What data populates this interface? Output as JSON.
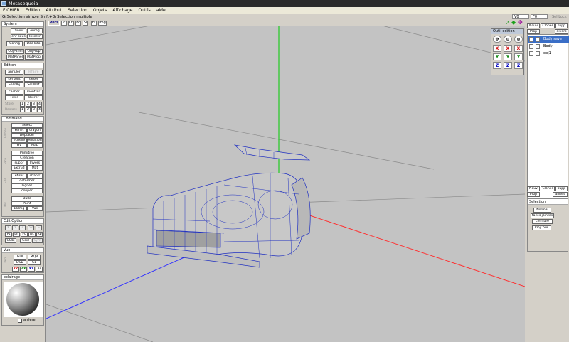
{
  "window": {
    "title": "Metasequoia"
  },
  "menu": [
    "FICHIER",
    "Edition",
    "Attribut",
    "Selection",
    "Objets",
    "Affichage",
    "Outils",
    "aide"
  ],
  "status": {
    "hint": "GrSelection simple  Shift+GrSelection multiple",
    "v_label": "V0",
    "f_label": "F0",
    "sel_lock": "Sel Lock"
  },
  "system": {
    "title": "System",
    "buttons": [
      "Ouvrir",
      "enreg",
      "enr sous",
      "Inserer",
      "Config",
      "Doc Info",
      "ObjPanel",
      "ObjProp",
      "MatPanel",
      "MatProp"
    ]
  },
  "edition": {
    "title": "Edition",
    "buttons": [
      "annuler",
      "refaire",
      "sel tout",
      "desel",
      "Sel Obj",
      "Sel Mat",
      "cacher",
      "montrer",
      "Fixer",
      "liberer"
    ],
    "store_label": "Store",
    "restore_label": "Restore",
    "nums": [
      "1",
      "2",
      "3",
      "4"
    ]
  },
  "command": {
    "title": "Command",
    "buttons": [
      "Select",
      "Fenet",
      "crayon",
      "Deplacer",
      "echelle",
      "Rotation",
      "HV",
      "Map",
      "Primitive",
      "Creation",
      "suppr",
      "Invers",
      "Extrud",
      "Mat",
      "etirer",
      "chanfr",
      "deformer",
      "Lignes",
      "couper",
      "Bulle",
      "Paint",
      "BkImg",
      "Vue"
    ],
    "side_labels": [
      "Edition",
      "Face",
      "Edit",
      "Mis"
    ]
  },
  "edit_option": {
    "title": "Edit Option",
    "buttons": [
      "X",
      "Y",
      "Z",
      "W",
      "S",
      "Pt",
      "Ln",
      "Fc",
      "Rc",
      "Rp",
      "CObj",
      "Grid",
      "Sym"
    ]
  },
  "vue": {
    "title": "Vue",
    "buttons": [
      "GDI",
      "MQR",
      "DSD",
      "GL",
      "YZ",
      "ZX",
      "XY",
      "Ar"
    ],
    "side_label": "Pers"
  },
  "eclairage": {
    "title": "eclairage",
    "checkbox_label": "arriere"
  },
  "viewport": {
    "tabs": [
      "Pers",
      "Pt",
      "Ln",
      "Fc",
      "Sl",
      "Fr",
      "Img"
    ],
    "active_tab": "Pers",
    "icons": [
      "nav-arrow-icon",
      "move-icon",
      "rotate-icon"
    ]
  },
  "outil": {
    "title": "Outil edition",
    "rows": [
      [
        "✥",
        "⊙",
        "⊚"
      ],
      [
        "X",
        "X",
        "X"
      ],
      [
        "Y",
        "Y",
        "Y"
      ],
      [
        "Z",
        "Z",
        "Z"
      ]
    ],
    "colors": {
      "X": "#d00000",
      "Y": "#008000",
      "Z": "#0000c0"
    }
  },
  "objects": {
    "buttons": [
      "Nouv",
      "Cloner",
      "supp",
      "Prop",
      "divers"
    ],
    "items": [
      {
        "name": "Body save",
        "selected": true
      },
      {
        "name": "Body",
        "selected": false
      },
      {
        "name": "obj1",
        "selected": false
      }
    ]
  },
  "materials": {
    "buttons": [
      "Nouv",
      "Cloner",
      "supp",
      "Prop",
      "divers"
    ]
  },
  "selection": {
    "title": "Selection",
    "buttons": [
      "Normal",
      "faces jointes",
      "ceinture",
      "ObjCour"
    ]
  },
  "axis_colors": {
    "x": "#ff3030",
    "y": "#00d000",
    "z": "#3030ff",
    "mesh": "#2030c0"
  }
}
